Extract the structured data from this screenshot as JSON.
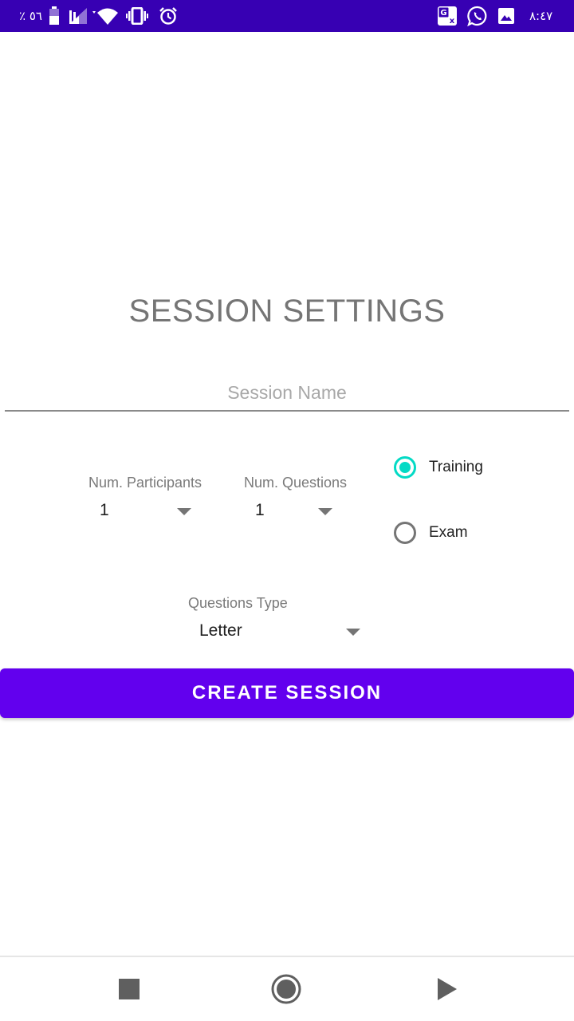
{
  "status_bar": {
    "battery_text": "٪ ٥٦",
    "time": "٨:٤٧",
    "icons": [
      "battery-icon",
      "signal-icon",
      "wifi-icon",
      "vibrate-icon",
      "alarm-icon",
      "translate-icon",
      "whatsapp-icon",
      "gallery-icon"
    ]
  },
  "title": "SESSION SETTINGS",
  "session_name": {
    "value": "",
    "placeholder": "Session Name"
  },
  "participants": {
    "label": "Num. Participants",
    "value": "1"
  },
  "questions": {
    "label": "Num. Questions",
    "value": "1"
  },
  "mode": {
    "options": [
      {
        "label": "Training",
        "checked": true
      },
      {
        "label": "Exam",
        "checked": false
      }
    ]
  },
  "questions_type": {
    "label": "Questions Type",
    "value": "Letter"
  },
  "create_button": {
    "label": "CREATE SESSION"
  },
  "nav_bar": {
    "icons": [
      "stop-icon",
      "record-icon",
      "play-icon"
    ]
  },
  "colors": {
    "status_bar": "#3700b3",
    "primary": "#6200ee",
    "accent": "#03dac5"
  }
}
